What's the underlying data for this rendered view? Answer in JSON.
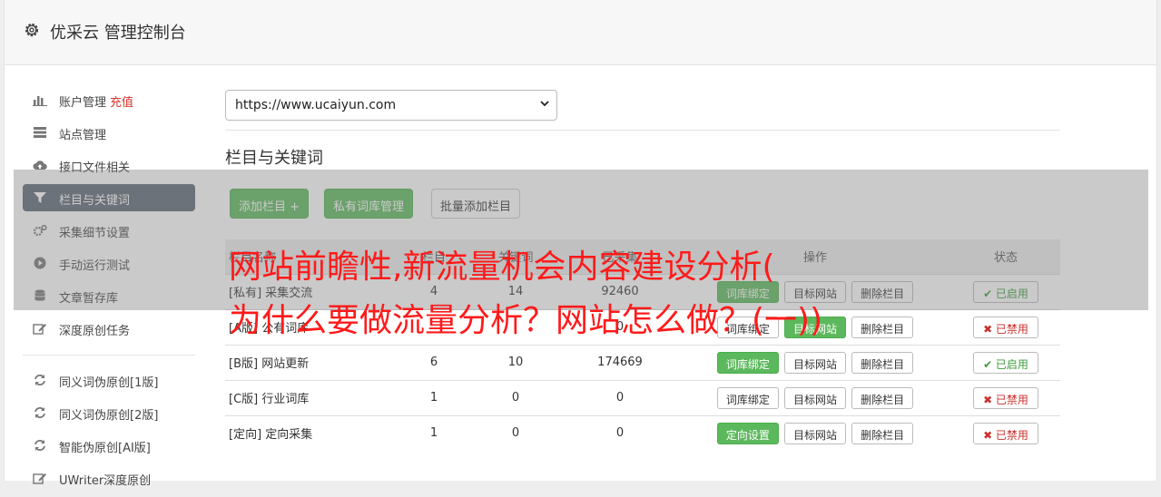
{
  "header": {
    "title": "优采云 管理控制台",
    "icon": "gear-icon"
  },
  "sidebar": {
    "items": [
      {
        "label": "账户管理",
        "extra": "充值",
        "icon": "bar-chart-icon",
        "active": false
      },
      {
        "label": "站点管理",
        "icon": "server-icon",
        "active": false
      },
      {
        "label": "接口文件相关",
        "icon": "cloud-upload-icon",
        "active": false
      },
      {
        "label": "栏目与关键词",
        "icon": "filter-icon",
        "active": true
      },
      {
        "label": "采集细节设置",
        "icon": "cogs-icon",
        "active": false
      },
      {
        "label": "手动运行测试",
        "icon": "play-circle-icon",
        "active": false
      },
      {
        "label": "文章暂存库",
        "icon": "database-icon",
        "active": false
      },
      {
        "label": "深度原创任务",
        "icon": "edit-icon",
        "active": false
      }
    ],
    "items2": [
      {
        "label": "同义词伪原创[1版]",
        "icon": "refresh-icon"
      },
      {
        "label": "同义词伪原创[2版]",
        "icon": "refresh-icon"
      },
      {
        "label": "智能伪原创[AI版]",
        "icon": "refresh-icon"
      },
      {
        "label": "UWriter深度原创",
        "icon": "edit-icon"
      }
    ]
  },
  "main": {
    "site_select": "https://www.ucaiyun.com",
    "section_title": "栏目与关键词",
    "buttons": {
      "add": "添加栏目 +",
      "private": "私有词库管理",
      "batch": "批量添加栏目"
    },
    "table": {
      "headers": [
        "栏目名称",
        "栏目",
        "关键词",
        "已采集",
        "操作",
        "状态"
      ],
      "rows": [
        {
          "tag": "[私有]",
          "name": "采集交流",
          "n1": "4",
          "n2": "14",
          "n3": "92460",
          "op1": "词库绑定",
          "op1_green": true,
          "op2": "目标网站",
          "op3": "删除栏目",
          "status": "✔ 已启用",
          "on": true
        },
        {
          "tag": "[A版]",
          "name": "公有词库",
          "n1": "",
          "n2": "",
          "n3": "0",
          "op1": "词库绑定",
          "op1_green": false,
          "op2": "目标网站",
          "op3": "删除栏目",
          "status": "✖ 已禁用",
          "on": false
        },
        {
          "tag": "[B版]",
          "name": "网站更新",
          "n1": "6",
          "n2": "10",
          "n3": "174669",
          "op1": "词库绑定",
          "op1_green": true,
          "op2": "目标网站",
          "op3": "删除栏目",
          "status": "✔ 已启用",
          "on": true
        },
        {
          "tag": "[C版]",
          "name": "行业词库",
          "n1": "1",
          "n2": "0",
          "n3": "0",
          "op1": "词库绑定",
          "op1_green": false,
          "op2": "目标网站",
          "op3": "删除栏目",
          "status": "✖ 已禁用",
          "on": false
        },
        {
          "tag": "[定向]",
          "name": "定向采集",
          "n1": "1",
          "n2": "0",
          "n3": "0",
          "op1": "定向设置",
          "op1_green": true,
          "op2": "目标网站",
          "op3": "删除栏目",
          "status": "✖ 已禁用",
          "on": false
        }
      ]
    }
  },
  "overlay": {
    "line1": "网站前瞻性,新流量机会内容建设分析(",
    "line2": "为什么要做流量分析？网站怎么做？(一))",
    "color": "#ff1a1a"
  }
}
